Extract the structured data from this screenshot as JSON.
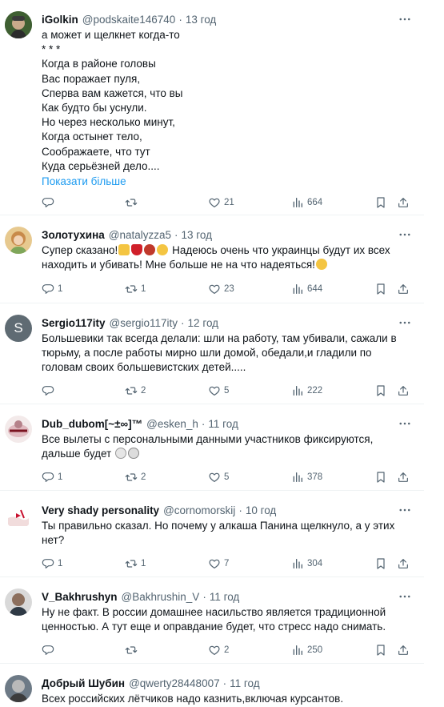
{
  "colors": {
    "accent": "#1d9bf0",
    "secondary_text": "#536471",
    "divider": "#eff3f4"
  },
  "icons": {
    "reply": "speech-bubble-icon",
    "retweet": "retweet-arrows-icon",
    "like": "heart-icon",
    "views": "bar-chart-icon",
    "bookmark": "bookmark-icon",
    "share": "share-arrow-icon",
    "more": "more-dots-icon"
  },
  "posts": [
    {
      "name": "iGolkin",
      "handle": "@podskaite146740",
      "time": "13 год",
      "text": "а может и щелкнет когда-то\n*    *    *\nКогда в районе головы\nВас поражает пуля,\nСперва вам кажется, что вы\nКак будто бы уснули.\nНо через несколько минут,\nКогда остынет тело,\nСоображаете, что тут\nКуда серьёзней дело....",
      "show_more": "Показати більше",
      "replies": "",
      "retweets": "",
      "likes": "21",
      "views": "664"
    },
    {
      "name": "Золотухина",
      "handle": "@natalyzza5",
      "time": "13 год",
      "text_a": "Супер сказано!",
      "text_b": " Надеюсь очень что украинцы будут их всех находить и убивать! Мне больше не на что надеяться!",
      "replies": "1",
      "retweets": "1",
      "likes": "23",
      "views": "644"
    },
    {
      "name": "Sergio117ity",
      "handle": "@sergio117ity",
      "time": "12 год",
      "avatar_letter": "S",
      "text": "Большевики так всегда делали: шли на работу, там убивали, сажали в тюрьму, а после работы мирно шли домой, обедали,и гладили по головам своих большевистских детей.....",
      "replies": "",
      "retweets": "2",
      "likes": "5",
      "views": "222"
    },
    {
      "name": "Dub_dubom[~±∞]™",
      "handle": "@esken_h",
      "time": "11 год",
      "text": "Все вылеты с персональными данными участников фиксируются, дальше будет ",
      "replies": "1",
      "retweets": "2",
      "likes": "5",
      "views": "378"
    },
    {
      "name": "Very shady personality",
      "handle": "@cornomorskij",
      "time": "10 год",
      "text": "Ты правильно сказал. Но почему у алкаша Панина щелкнуло, а у этих нет?",
      "replies": "1",
      "retweets": "1",
      "likes": "7",
      "views": "304"
    },
    {
      "name": "V_Bakhrushyn",
      "handle": "@Bakhrushin_V",
      "time": "11 год",
      "text": "Ну не факт. В россии домашнее насильство является традиционной ценностью. А тут еще и оправдание будет, что стресс надо снимать.",
      "replies": "",
      "retweets": "",
      "likes": "2",
      "views": "250"
    },
    {
      "name": "Добрый Шубин",
      "handle": "@qwerty28448007",
      "time": "11 год",
      "text": "Всех российских лётчиков надо казнить,включая курсантов."
    }
  ]
}
